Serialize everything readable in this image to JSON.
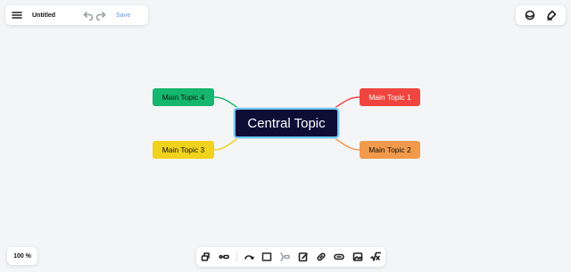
{
  "document": {
    "title": "Untitled"
  },
  "toolbar": {
    "save_label": "Save",
    "undo_icon": "undo-icon",
    "redo_icon": "redo-icon"
  },
  "zoom": {
    "label": "100 %"
  },
  "mindmap": {
    "central": "Central Topic",
    "topics": [
      {
        "label": "Main Topic 1",
        "color": "#f0443e"
      },
      {
        "label": "Main Topic 2",
        "color": "#f29a4c"
      },
      {
        "label": "Main Topic 3",
        "color": "#f1d21d"
      },
      {
        "label": "Main Topic 4",
        "color": "#15b66d"
      }
    ],
    "central_bg": "#0d0d35",
    "central_border": "#6ec4f2"
  },
  "bottom_tools": [
    "add-topic-icon",
    "connect-icon",
    "relationship-icon",
    "boundary-icon",
    "summary-icon",
    "note-icon",
    "link-icon",
    "label-icon",
    "image-icon",
    "formula-icon"
  ],
  "top_right_tools": [
    "theme-icon",
    "style-icon"
  ]
}
